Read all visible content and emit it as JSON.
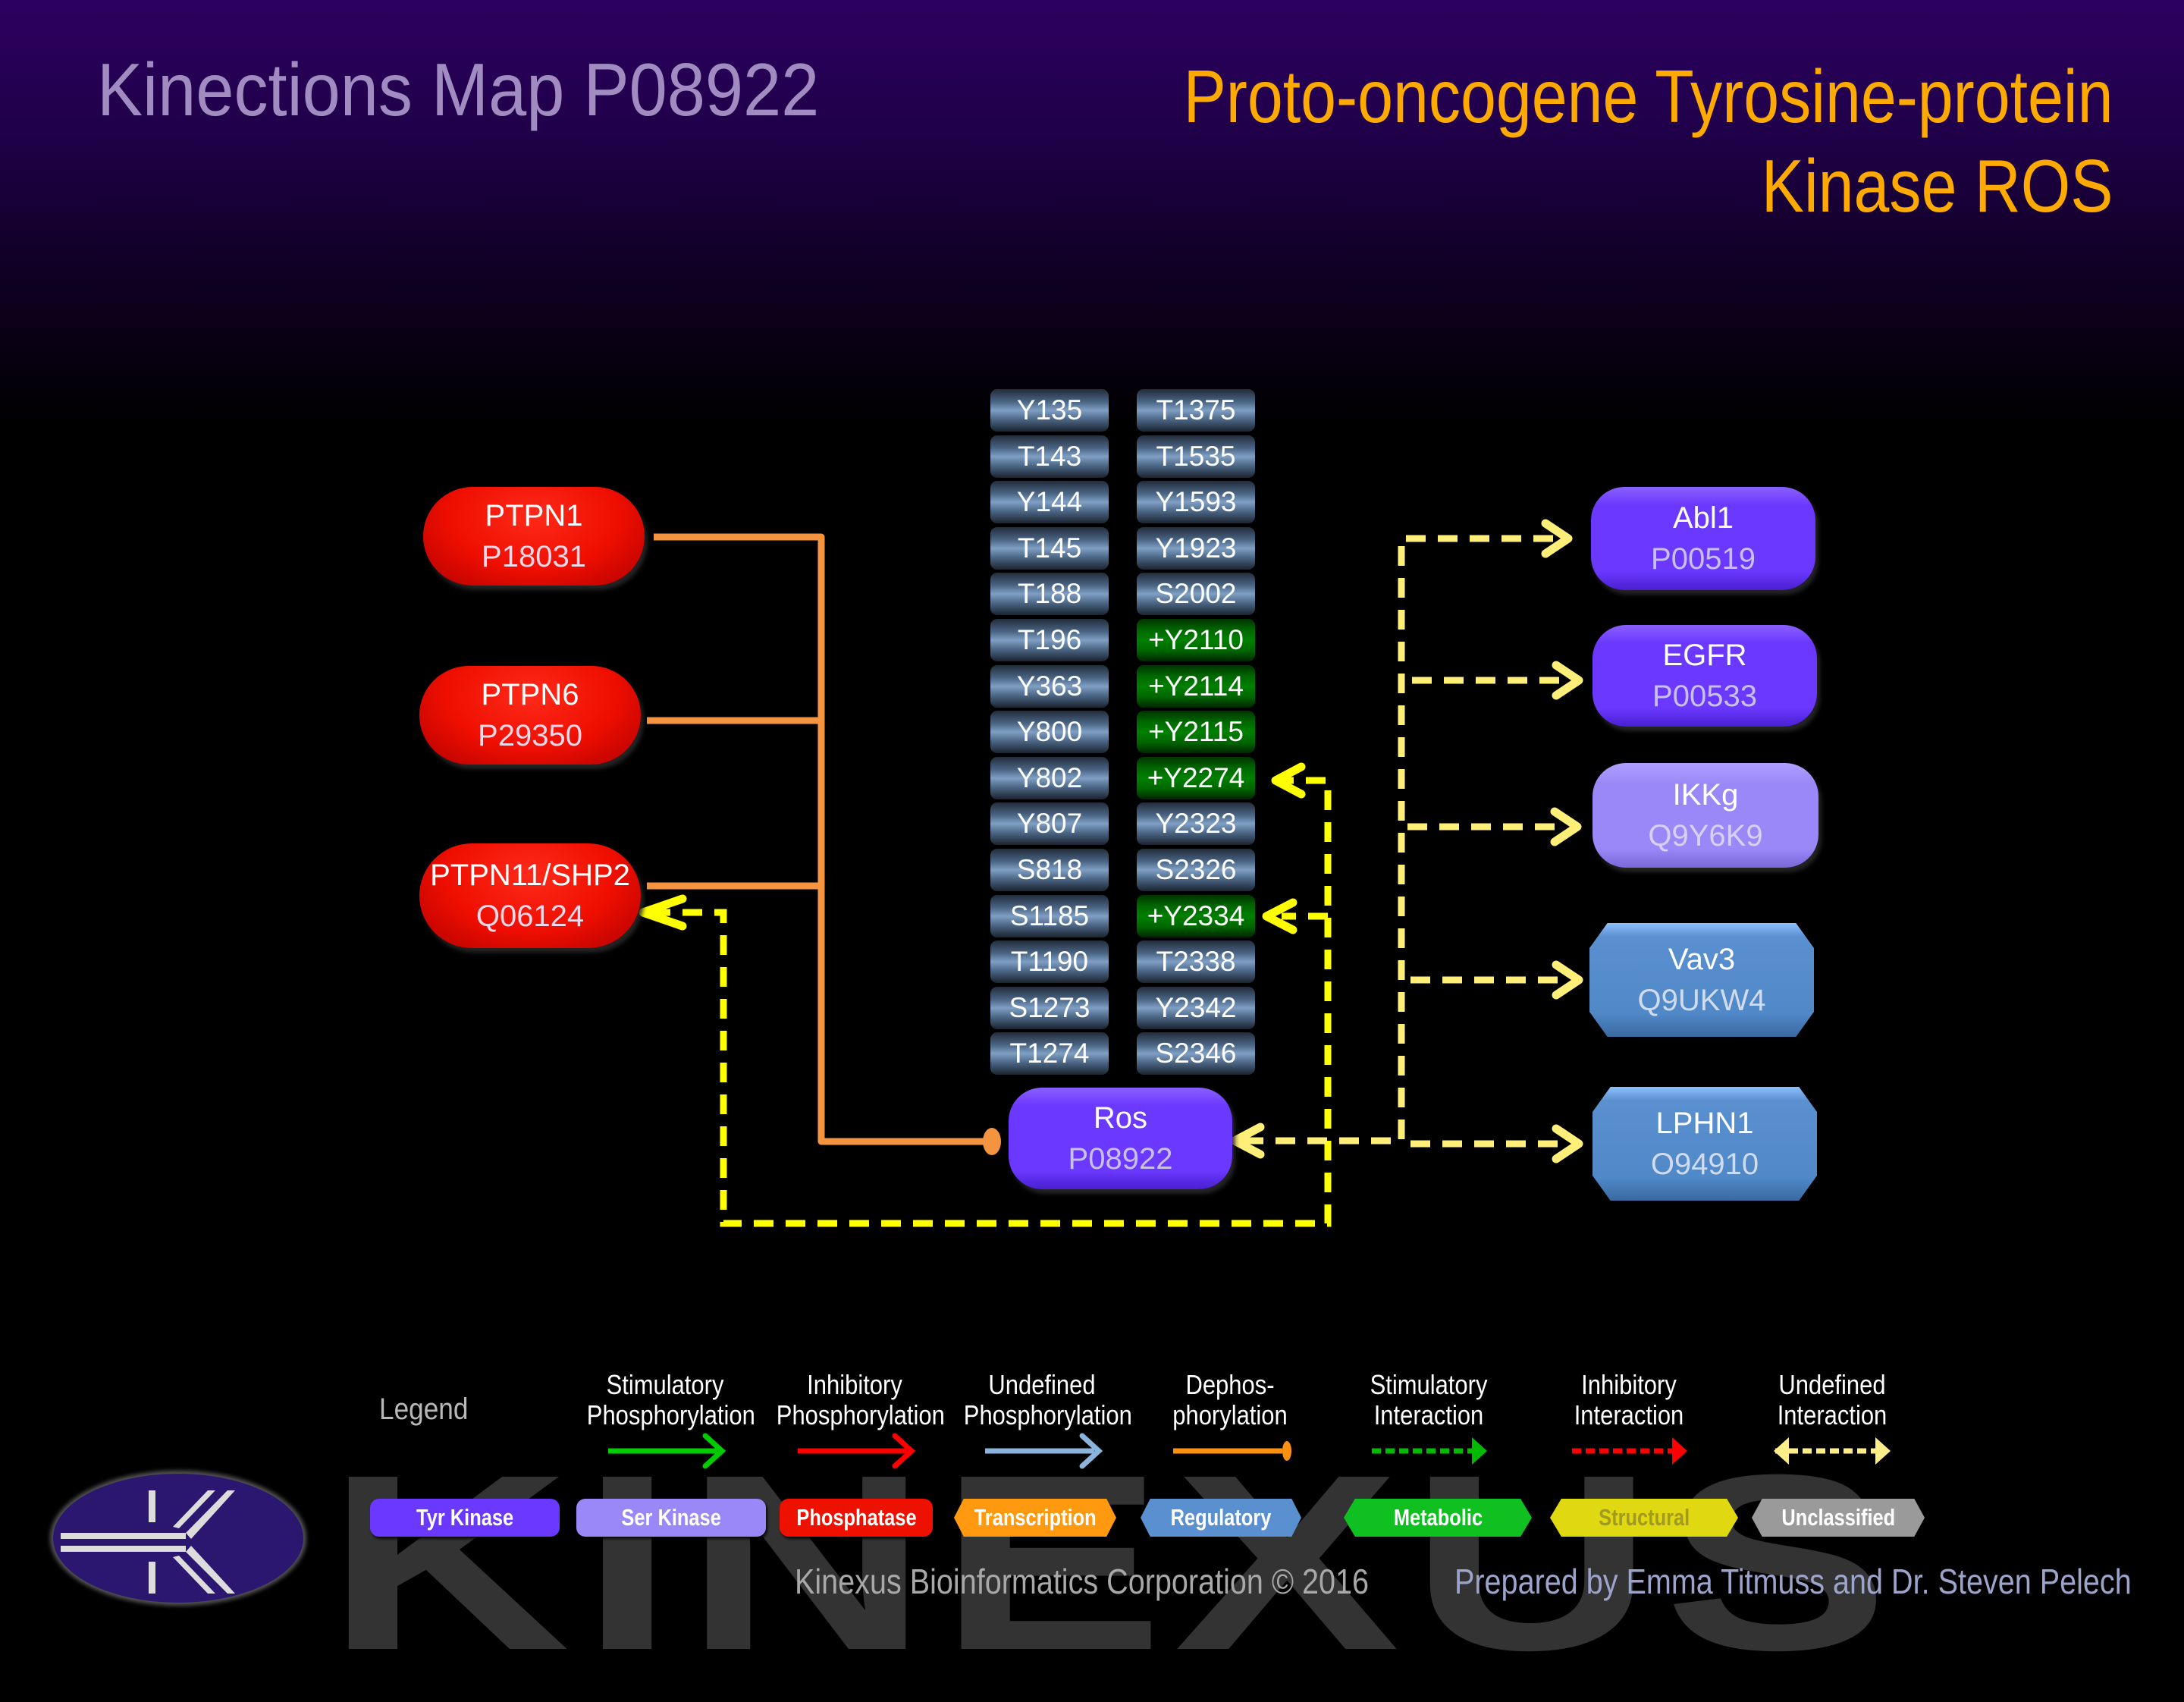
{
  "header": {
    "map_title": "Kinections Map P08922",
    "protein_name_line1": "Proto-oncogene Tyrosine-protein",
    "protein_name_line2": "Kinase ROS"
  },
  "colors": {
    "title_left": "#a08cc0",
    "title_right": "#ffaa00",
    "dephosphorylation_line": "#f59440",
    "interaction_line_pale": "#ffee77",
    "interaction_line_bright": "#ffff00",
    "active_site": "#008000",
    "inactive_site": "#6a8aae"
  },
  "sites": {
    "column1": [
      {
        "label": "Y135",
        "active": false
      },
      {
        "label": "T143",
        "active": false
      },
      {
        "label": "Y144",
        "active": false
      },
      {
        "label": "T145",
        "active": false
      },
      {
        "label": "T188",
        "active": false
      },
      {
        "label": "T196",
        "active": false
      },
      {
        "label": "Y363",
        "active": false
      },
      {
        "label": "Y800",
        "active": false
      },
      {
        "label": "Y802",
        "active": false
      },
      {
        "label": "Y807",
        "active": false
      },
      {
        "label": "S818",
        "active": false
      },
      {
        "label": "S1185",
        "active": false
      },
      {
        "label": "T1190",
        "active": false
      },
      {
        "label": "S1273",
        "active": false
      },
      {
        "label": "T1274",
        "active": false
      }
    ],
    "column2": [
      {
        "label": "T1375",
        "active": false
      },
      {
        "label": "T1535",
        "active": false
      },
      {
        "label": "Y1593",
        "active": false
      },
      {
        "label": "Y1923",
        "active": false
      },
      {
        "label": "S2002",
        "active": false
      },
      {
        "label": "+Y2110",
        "active": true
      },
      {
        "label": "+Y2114",
        "active": true
      },
      {
        "label": "+Y2115",
        "active": true
      },
      {
        "label": "+Y2274",
        "active": true
      },
      {
        "label": "Y2323",
        "active": false
      },
      {
        "label": "S2326",
        "active": false
      },
      {
        "label": "+Y2334",
        "active": true
      },
      {
        "label": "T2338",
        "active": false
      },
      {
        "label": "Y2342",
        "active": false
      },
      {
        "label": "S2346",
        "active": false
      }
    ]
  },
  "nodes": {
    "center": {
      "name": "Ros",
      "accession": "P08922",
      "type": "Tyr Kinase"
    },
    "upstream": [
      {
        "name": "PTPN1",
        "accession": "P18031",
        "type": "Phosphatase",
        "relation": "Dephosphorylation"
      },
      {
        "name": "PTPN6",
        "accession": "P29350",
        "type": "Phosphatase",
        "relation": "Dephosphorylation"
      },
      {
        "name": "PTPN11/SHP2",
        "accession": "Q06124",
        "type": "Phosphatase",
        "relation": "Dephosphorylation; Undefined Interaction"
      }
    ],
    "downstream": [
      {
        "name": "Abl1",
        "accession": "P00519",
        "type": "Tyr Kinase",
        "relation": "Undefined Interaction"
      },
      {
        "name": "EGFR",
        "accession": "P00533",
        "type": "Tyr Kinase",
        "relation": "Undefined Interaction"
      },
      {
        "name": "IKKg",
        "accession": "Q9Y6K9",
        "type": "Ser Kinase",
        "relation": "Undefined Interaction"
      },
      {
        "name": "Vav3",
        "accession": "Q9UKW4",
        "type": "Regulatory",
        "relation": "Undefined Interaction"
      },
      {
        "name": "LPHN1",
        "accession": "O94910",
        "type": "Regulatory",
        "relation": "Undefined Interaction"
      }
    ]
  },
  "legend": {
    "title": "Legend",
    "line_types": [
      {
        "line1": "Stimulatory",
        "line2": "Phosphorylation",
        "color": "#00cc00",
        "style": "solid-arrow"
      },
      {
        "line1": "Inhibitory",
        "line2": "Phosphorylation",
        "color": "#ff0000",
        "style": "solid-arrow"
      },
      {
        "line1": "Undefined",
        "line2": "Phosphorylation",
        "color": "#8ab4dc",
        "style": "solid-arrow"
      },
      {
        "line1": "Dephos-",
        "line2": "phorylation",
        "color": "#ff9010",
        "style": "solid-dot"
      },
      {
        "line1": "Stimulatory",
        "line2": "Interaction",
        "color": "#00bb00",
        "style": "dashed-arrow"
      },
      {
        "line1": "Inhibitory",
        "line2": "Interaction",
        "color": "#ff0000",
        "style": "dashed-arrow"
      },
      {
        "line1": "Undefined",
        "line2": "Interaction",
        "color": "#ffee88",
        "style": "dashed-double-arrow"
      }
    ],
    "node_types": [
      {
        "label": "Tyr Kinase",
        "color": "#6a38ff",
        "text_color": "#ffffff",
        "shape": "pill"
      },
      {
        "label": "Ser Kinase",
        "color": "#9a88f8",
        "text_color": "#ffffff",
        "shape": "pill"
      },
      {
        "label": "Phosphatase",
        "color": "#ee1100",
        "text_color": "#ffffff",
        "shape": "pill"
      },
      {
        "label": "Transcription",
        "color": "#ff9a10",
        "text_color": "#ffffff",
        "shape": "hex"
      },
      {
        "label": "Regulatory",
        "color": "#5a90d0",
        "text_color": "#ffffff",
        "shape": "hex"
      },
      {
        "label": "Metabolic",
        "color": "#10c020",
        "text_color": "#ffffff",
        "shape": "hex"
      },
      {
        "label": "Structural",
        "color": "#e0d810",
        "text_color": "#a09a20",
        "shape": "hex"
      },
      {
        "label": "Unclassified",
        "color": "#9a9a9a",
        "text_color": "#ffffff",
        "shape": "hex"
      }
    ]
  },
  "footer": {
    "watermark": "KINEXUS",
    "copyright": "Kinexus Bioinformatics Corporation © 2016",
    "prepared_by": "Prepared by Emma Titmuss and Dr. Steven Pelech"
  }
}
